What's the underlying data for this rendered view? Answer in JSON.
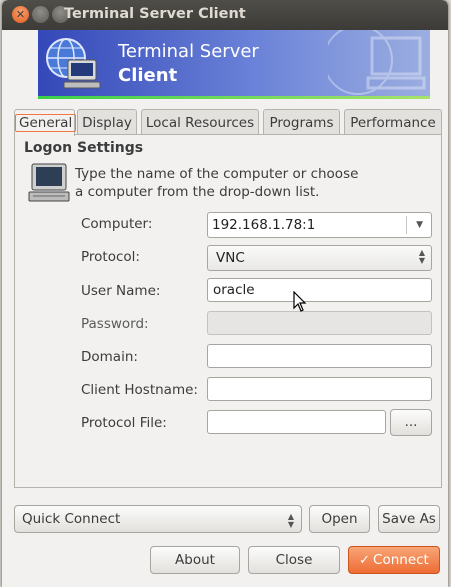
{
  "window": {
    "title": "Terminal Server Client"
  },
  "banner": {
    "title_line1": "Terminal Server",
    "title_line2": "Client"
  },
  "tabs": [
    {
      "label": "General",
      "active": true
    },
    {
      "label": "Display",
      "active": false
    },
    {
      "label": "Local Resources",
      "active": false
    },
    {
      "label": "Programs",
      "active": false
    },
    {
      "label": "Performance",
      "active": false
    }
  ],
  "logon": {
    "section_title": "Logon Settings",
    "description_line1": "Type the name of the computer or choose",
    "description_line2": "a computer from the drop-down list."
  },
  "fields": {
    "computer": {
      "label": "Computer:",
      "value": "192.168.1.78:1"
    },
    "protocol": {
      "label": "Protocol:",
      "value": "VNC"
    },
    "username": {
      "label": "User Name:",
      "value": "oracle"
    },
    "password": {
      "label": "Password:",
      "value": ""
    },
    "domain": {
      "label": "Domain:",
      "value": ""
    },
    "client_hostname": {
      "label": "Client Hostname:",
      "value": ""
    },
    "protocol_file": {
      "label": "Protocol File:",
      "value": "",
      "browse_label": "..."
    }
  },
  "quick_connect": {
    "value": "Quick Connect",
    "open_label": "Open",
    "save_as_label": "Save As"
  },
  "buttons": {
    "about": "About",
    "close": "Close",
    "connect": "Connect"
  },
  "colors": {
    "accent": "#ee6c34",
    "banner": "#3448b8",
    "titlebar": "#3c3b37"
  },
  "icons": {
    "close": "close-icon",
    "minimize": "minimize-icon",
    "maximize": "maximize-icon",
    "computer": "computer-icon"
  }
}
